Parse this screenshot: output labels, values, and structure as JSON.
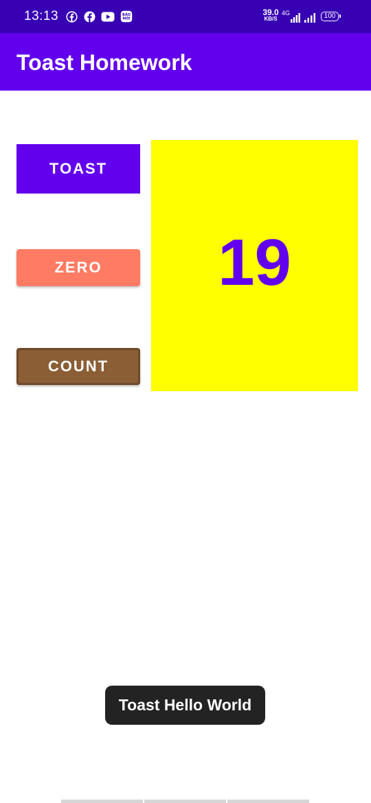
{
  "status_bar": {
    "time": "13:13",
    "left_icons": [
      "facebook-outline-icon",
      "facebook-icon",
      "youtube-icon",
      "bao-moi-icon"
    ],
    "bao_moi_text": "BAO MOI",
    "net_speed_value": "39.0",
    "net_speed_unit": "KB/S",
    "network_type": "4G",
    "battery_level": "100",
    "colors": {
      "background": "#3700b3"
    }
  },
  "app_bar": {
    "title": "Toast Homework",
    "colors": {
      "background": "#6200ee"
    }
  },
  "buttons": {
    "toast_label": "Toast",
    "zero_label": "Zero",
    "count_label": "Count",
    "colors": {
      "toast": "#6200ee",
      "zero": "#ff7b63",
      "count": "#8b5e35"
    }
  },
  "counter": {
    "value": "19",
    "colors": {
      "panel": "#ffff00",
      "text": "#6200ee"
    }
  },
  "toast": {
    "message": "Toast Hello World"
  }
}
